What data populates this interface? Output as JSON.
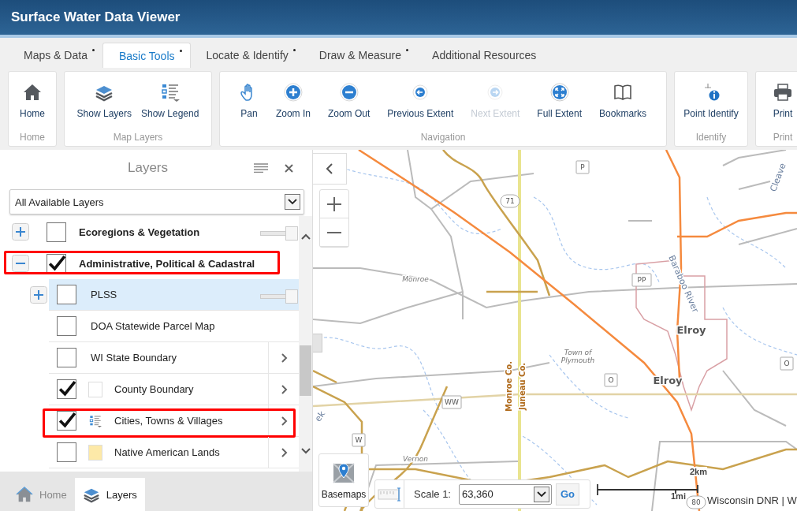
{
  "window": {
    "title": "Surface Water Data Viewer"
  },
  "tabs": [
    {
      "label": "Maps & Data",
      "selected": false,
      "dot": true
    },
    {
      "label": "Basic Tools",
      "selected": true,
      "dot": true
    },
    {
      "label": "Locate & Identify",
      "selected": false,
      "dot": true
    },
    {
      "label": "Draw & Measure",
      "selected": false,
      "dot": true
    },
    {
      "label": "Additional Resources",
      "selected": false,
      "dot": false
    }
  ],
  "ribbon": [
    {
      "group": "Home",
      "buttons": [
        {
          "label": "Home",
          "disabled": false
        }
      ]
    },
    {
      "group": "Map Layers",
      "buttons": [
        {
          "label": "Show Layers",
          "disabled": false
        },
        {
          "label": "Show Legend",
          "disabled": false
        }
      ]
    },
    {
      "group": "Navigation",
      "buttons": [
        {
          "label": "Pan",
          "disabled": false
        },
        {
          "label": "Zoom In",
          "disabled": false
        },
        {
          "label": "Zoom Out",
          "disabled": false
        },
        {
          "label": "Previous Extent",
          "disabled": false
        },
        {
          "label": "Next Extent",
          "disabled": true
        },
        {
          "label": "Full Extent",
          "disabled": false
        },
        {
          "label": "Bookmarks",
          "disabled": false
        }
      ]
    },
    {
      "group": "Identify",
      "buttons": [
        {
          "label": "Point Identify",
          "disabled": false
        }
      ]
    },
    {
      "group": "Print",
      "buttons": [
        {
          "label": "Print",
          "disabled": false
        }
      ]
    }
  ],
  "layers_panel": {
    "title": "Layers",
    "filter": "All Available Layers",
    "rows": [
      {
        "label": "Ecoregions & Vegetation",
        "checked": false,
        "expanded": false,
        "highlighted": false,
        "level": 1
      },
      {
        "label": "Administrative, Political & Cadastral",
        "checked": true,
        "expanded": true,
        "highlighted": true,
        "children": [
          {
            "label": "PLSS",
            "kind": "group",
            "checked": false,
            "selected": true,
            "expanded": false,
            "highlighted": false,
            "level": 1
          },
          {
            "label": "DOA Statewide Parcel Map",
            "kind": "plain",
            "checked": false,
            "selected": false,
            "highlighted": false
          },
          {
            "label": "WI State Boundary",
            "kind": "plain",
            "checked": false,
            "selected": false,
            "highlighted": false,
            "details": true
          },
          {
            "label": "County Boundary",
            "kind": "swatch",
            "color": "#ffffff",
            "checked": true,
            "selected": false,
            "highlighted": false,
            "details": true
          },
          {
            "label": "Cities, Towns & Villages",
            "kind": "legend",
            "checked": true,
            "selected": false,
            "highlighted": true,
            "details": true
          },
          {
            "label": "Native American Lands",
            "kind": "swatch",
            "color": "#fde9a8",
            "checked": false,
            "selected": false,
            "highlighted": false,
            "details": true
          }
        ]
      }
    ]
  },
  "bottom_tabs": [
    {
      "label": "Home",
      "selected": false
    },
    {
      "label": "Layers",
      "selected": true
    }
  ],
  "map": {
    "labels": [
      {
        "text": "P",
        "kind": "shield"
      },
      {
        "text": "71",
        "kind": "round-shield"
      },
      {
        "text": "Cleave",
        "kind": "water"
      },
      {
        "text": "Monroe",
        "kind": "place"
      },
      {
        "text": "PP",
        "kind": "shield"
      },
      {
        "text": "Baraboo River",
        "kind": "water"
      },
      {
        "text": "Elroy",
        "kind": "city"
      },
      {
        "text": "Town of Plymouth",
        "kind": "place"
      },
      {
        "text": "O",
        "kind": "shield"
      },
      {
        "text": "Elroy",
        "kind": "city"
      },
      {
        "text": "O",
        "kind": "shield"
      },
      {
        "text": "Monroe Co.",
        "kind": "county"
      },
      {
        "text": "Juneau Co.",
        "kind": "county"
      },
      {
        "text": "WW",
        "kind": "shield"
      },
      {
        "text": "ek",
        "kind": "water"
      },
      {
        "text": "W",
        "kind": "shield"
      },
      {
        "text": "Vernon",
        "kind": "place"
      },
      {
        "text": "80",
        "kind": "round-shield"
      }
    ],
    "basemaps": "Basemaps",
    "scale_label": "Scale 1:",
    "scale_value": "63,360",
    "go": "Go",
    "scale_bar": [
      "2km",
      "1mi"
    ],
    "attribution": "Wisconsin DNR | W"
  }
}
